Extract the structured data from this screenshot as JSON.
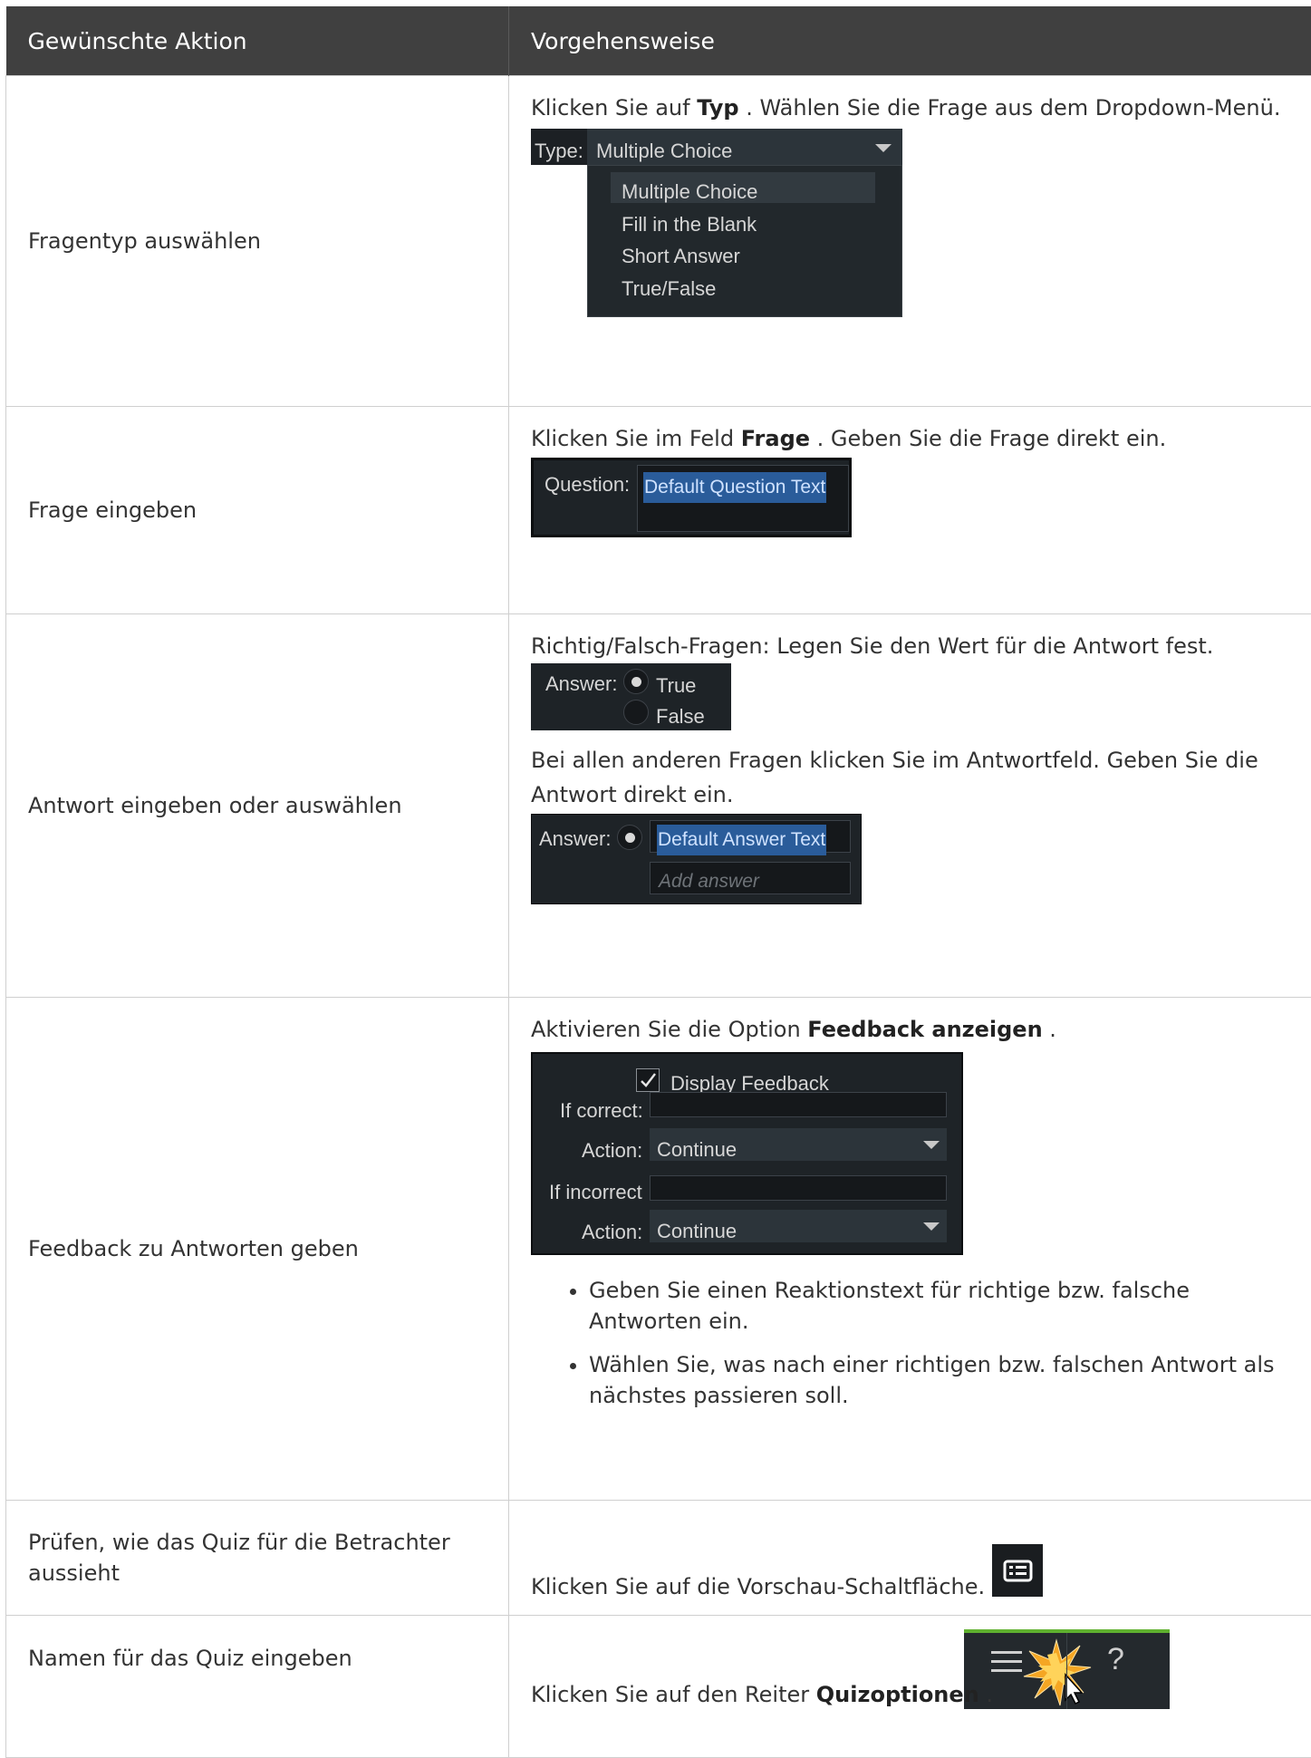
{
  "header": {
    "col1": "Gewünschte Aktion",
    "col2": "Vorgehensweise"
  },
  "rows": [
    {
      "action": "Fragentyp auswählen",
      "text_pre": "Klicken Sie auf ",
      "text_bold": "Typ",
      "text_post": " . Wählen Sie die Frage aus dem Dropdown-Menü.",
      "ui": {
        "type_label": "Type:",
        "selected": "Multiple Choice",
        "options": [
          "Multiple Choice",
          "Fill in the Blank",
          "Short Answer",
          "True/False"
        ]
      }
    },
    {
      "action": "Frage eingeben",
      "text_pre": "Klicken Sie im Feld ",
      "text_bold": "Frage",
      "text_post": " . Geben Sie die Frage direkt ein.",
      "ui": {
        "label": "Question:",
        "value": "Default Question Text"
      }
    },
    {
      "action": "Antwort eingeben oder auswählen",
      "text1": "Richtig/Falsch-Fragen: Legen Sie den Wert für die Antwort fest.",
      "ui1": {
        "label": "Answer:",
        "opt_true": "True",
        "opt_false": "False"
      },
      "text2": "Bei allen anderen Fragen klicken Sie im Antwortfeld. Geben Sie die Antwort direkt ein.",
      "ui2": {
        "label": "Answer:",
        "value": "Default Answer Text",
        "placeholder": "Add answer"
      }
    },
    {
      "action": "Feedback zu Antworten geben",
      "text_pre": "Aktivieren Sie die Option ",
      "text_bold": "Feedback anzeigen",
      "text_post": " .",
      "ui": {
        "checkbox_label": "Display Feedback",
        "if_correct": "If correct:",
        "action_label_1": "Action:",
        "action_value_1": "Continue",
        "if_incorrect": "If incorrect",
        "action_label_2": "Action:",
        "action_value_2": "Continue"
      },
      "bullets": [
        "Geben Sie einen Reaktionstext für richtige bzw. falsche Antworten ein.",
        "Wählen Sie, was nach einer richtigen bzw. falschen Antwort als nächstes passieren soll."
      ]
    },
    {
      "action": "Prüfen, wie das Quiz für die Betrachter aussieht",
      "text": "Klicken Sie auf die Vorschau-Schaltfläche.",
      "icon": "preview-list-icon"
    },
    {
      "action": "Namen für das Quiz eingeben",
      "text_pre": "Klicken Sie auf den Reiter ",
      "text_bold": "Quizoptionen",
      "text_post": " .",
      "icons": [
        "menu-lines-icon",
        "help-question-icon"
      ],
      "help_glyph": "?"
    }
  ]
}
